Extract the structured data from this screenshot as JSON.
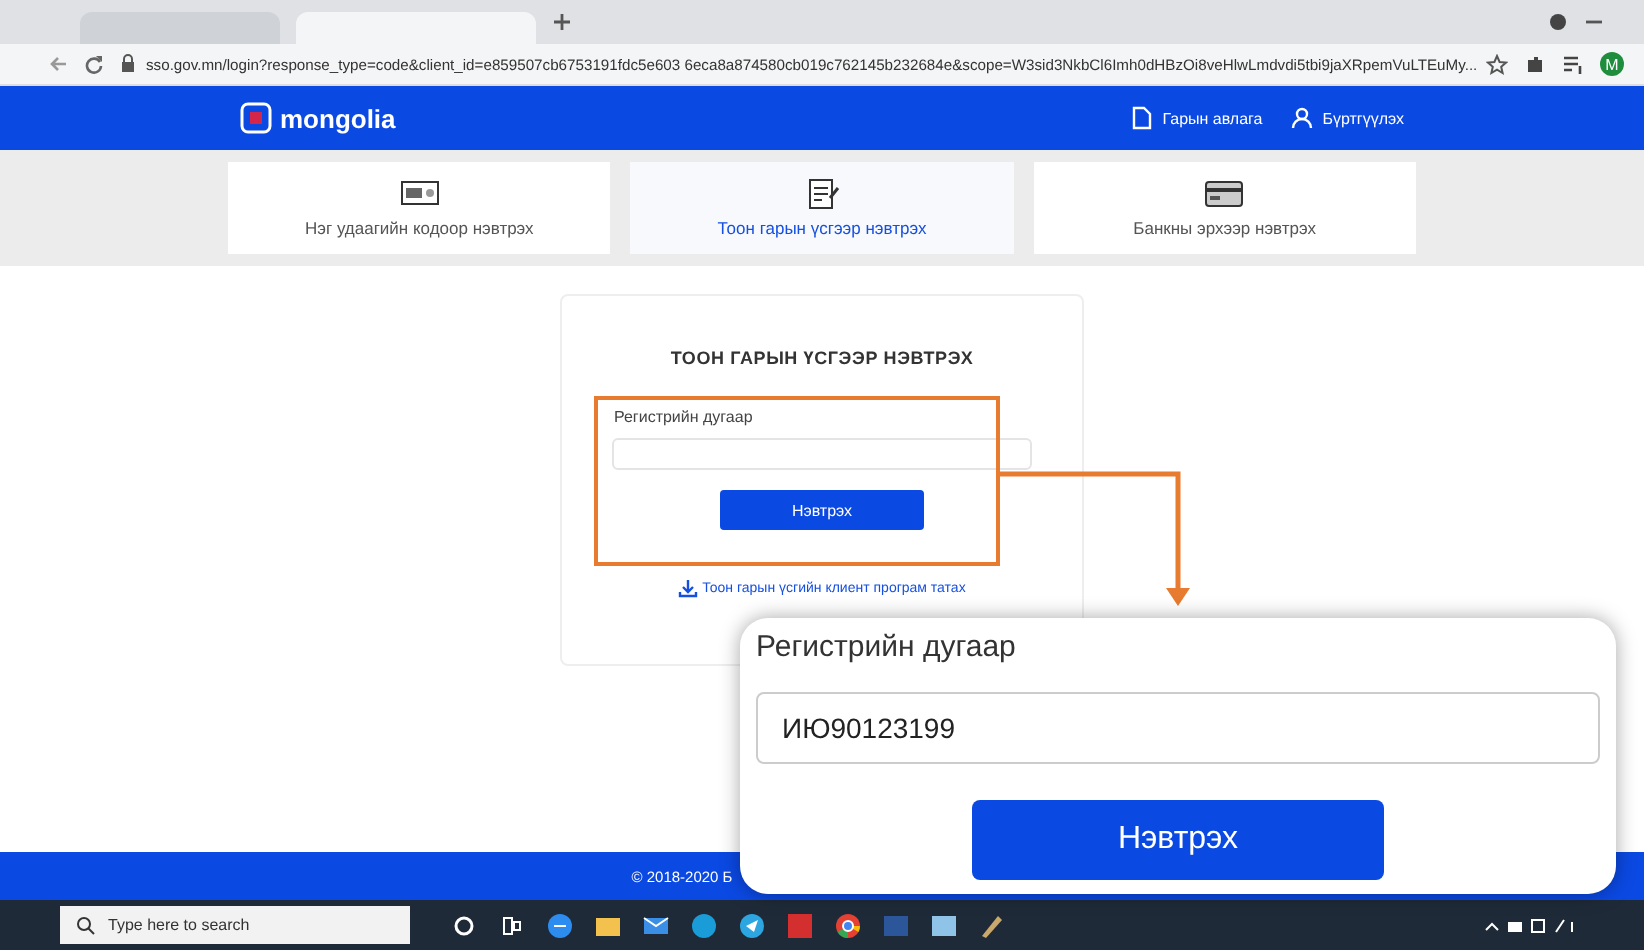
{
  "browser": {
    "url": "sso.gov.mn/login?response_type=code&client_id=e859507cb6753191fdc5e603 6eca8a874580cb019c762145b232684e&scope=W3sid3NkbCl6Imh0dHBzOi8veHlwLmdvdi5tbi9jaXRpemVuLTEuMy...",
    "profile_initial": "M"
  },
  "header": {
    "logo": "mongolia",
    "links": [
      {
        "label": "Гарын авлага",
        "kind": "doc"
      },
      {
        "label": "Бүртгүүлэх",
        "kind": "user"
      }
    ]
  },
  "login_methods": [
    {
      "label": "Нэг удаагийн кодоор нэвтрэх",
      "kind": "code",
      "selected": false
    },
    {
      "label": "Тоон гарын үсгээр нэвтрэх",
      "kind": "signature",
      "selected": true
    },
    {
      "label": "Банкны эрхээр нэвтрэх",
      "kind": "bank",
      "selected": false
    }
  ],
  "login_card": {
    "title": "ТООН ГАРЫН ҮСГЭЭР НЭВТРЭХ",
    "field_label": "Регистрийн дугаар",
    "button": "Нэвтрэх",
    "download_link": "Тоон гарын үсгийн клиент програм татах"
  },
  "callout": {
    "field_label": "Регистрийн дугаар",
    "value": "ИЮ90123199",
    "button": "Нэвтрэх"
  },
  "footer": {
    "copyright": "© 2018-2020 Б"
  },
  "taskbar": {
    "search_placeholder": "Type here to search"
  }
}
